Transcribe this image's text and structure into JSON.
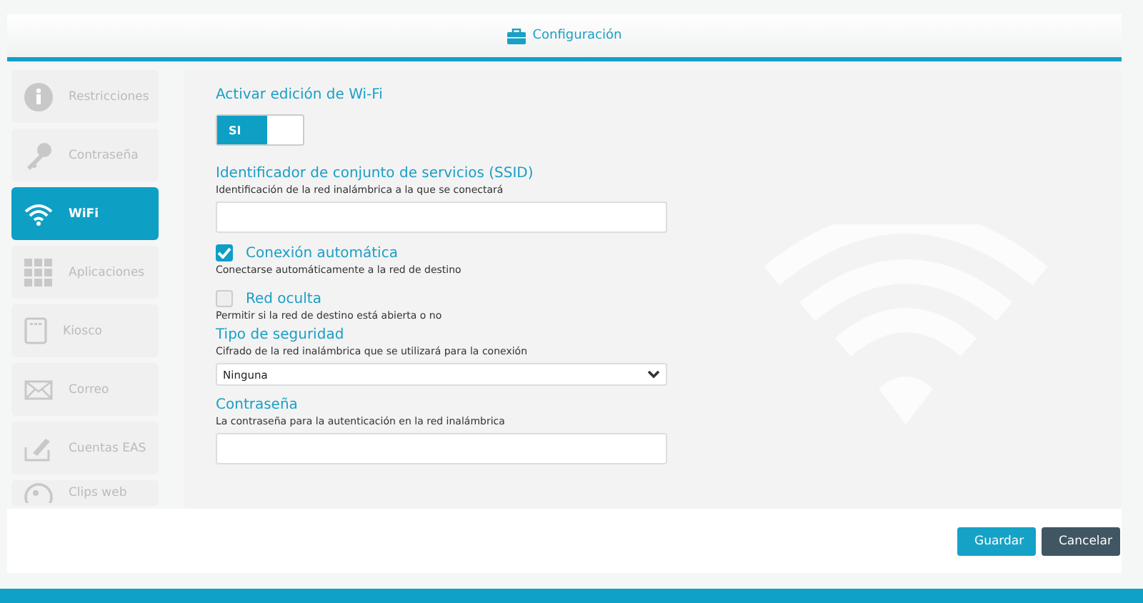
{
  "header": {
    "title": "Configuración"
  },
  "sidebar": {
    "items": [
      {
        "label": "Restricciones",
        "kind": "info",
        "selected": false
      },
      {
        "label": "Contraseña",
        "kind": "key",
        "selected": false
      },
      {
        "label": "WiFi",
        "kind": "wifi",
        "selected": true
      },
      {
        "label": "Aplicaciones",
        "kind": "grid",
        "selected": false
      },
      {
        "label": "Kiosco",
        "kind": "kiosk",
        "selected": false
      },
      {
        "label": "Correo",
        "kind": "mail",
        "selected": false
      },
      {
        "label": "Cuentas EAS",
        "kind": "eas",
        "selected": false
      },
      {
        "label": "Clips web",
        "kind": "clip",
        "selected": false
      }
    ]
  },
  "form": {
    "fields": [
      {
        "kind": "toggle",
        "label": "Activar edición de Wi-Fi",
        "on": true,
        "on_label": "SI"
      },
      {
        "kind": "text",
        "label": "Identificador de conjunto de servicios (SSID)",
        "description": "Identificación de la red inalámbrica a la que se conectará"
      },
      {
        "kind": "checkbox",
        "label": "Conexión automática",
        "description": "Conectarse automáticamente a la red de destino",
        "checked": true
      },
      {
        "kind": "checkbox",
        "label": "Red oculta",
        "description": "Permitir si la red de destino está abierta o no",
        "checked": false
      },
      {
        "kind": "select",
        "label": "Tipo de seguridad",
        "description": "Cifrado de la red inalámbrica que se utilizará para la conexión",
        "value": "Ninguna"
      },
      {
        "kind": "text",
        "label": "Contraseña",
        "description": "La contraseña para la autenticación en la red inalámbrica"
      }
    ]
  },
  "buttons": [
    {
      "label": "Guardar",
      "kind": "primary"
    },
    {
      "label": "Cancelar",
      "kind": "secondary"
    }
  ]
}
